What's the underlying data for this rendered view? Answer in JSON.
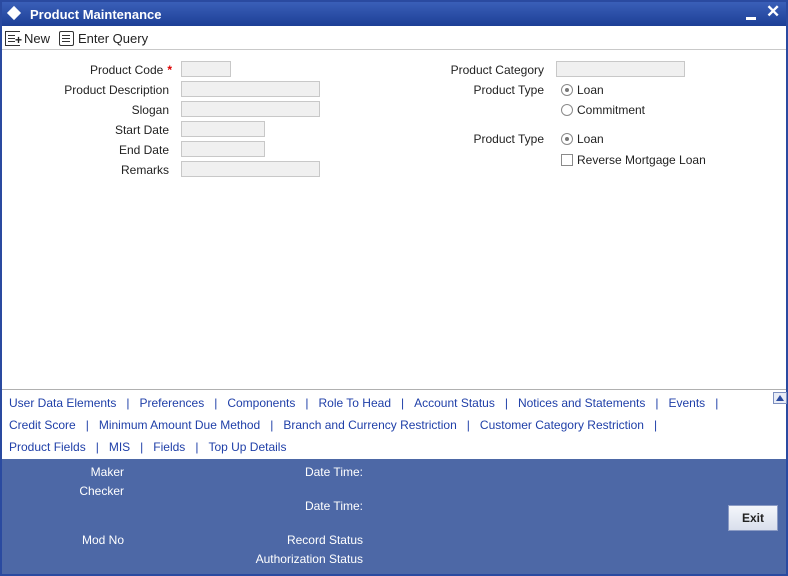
{
  "window": {
    "title": "Product Maintenance"
  },
  "toolbar": {
    "new_label": "New",
    "enter_query_label": "Enter Query"
  },
  "form": {
    "product_code_label": "Product Code",
    "required_mark": "*",
    "product_description_label": "Product Description",
    "slogan_label": "Slogan",
    "start_date_label": "Start Date",
    "end_date_label": "End Date",
    "remarks_label": "Remarks",
    "product_category_label": "Product Category",
    "product_type_label_1": "Product Type",
    "product_type_options_1": [
      "Loan",
      "Commitment"
    ],
    "product_type_selected_1": "Loan",
    "product_type_label_2": "Product Type",
    "product_type_options_2": [
      "Loan"
    ],
    "product_type_selected_2": "Loan",
    "reverse_mortgage_label": "Reverse Mortgage Loan",
    "reverse_mortgage_checked": false
  },
  "links": {
    "row1": [
      "User Data Elements",
      "Preferences",
      "Components",
      "Role To Head",
      "Account Status",
      "Notices and Statements",
      "Events"
    ],
    "row2": [
      "Credit Score",
      "Minimum Amount Due Method",
      "Branch and Currency Restriction",
      "Customer Category Restriction"
    ],
    "row3": [
      "Product Fields",
      "MIS",
      "Fields",
      "Top Up Details"
    ],
    "separator": "|"
  },
  "footer": {
    "maker_label": "Maker",
    "checker_label": "Checker",
    "mod_no_label": "Mod No",
    "date_time_label": "Date Time:",
    "record_status_label": "Record Status",
    "authorization_status_label": "Authorization Status",
    "exit_label": "Exit"
  }
}
